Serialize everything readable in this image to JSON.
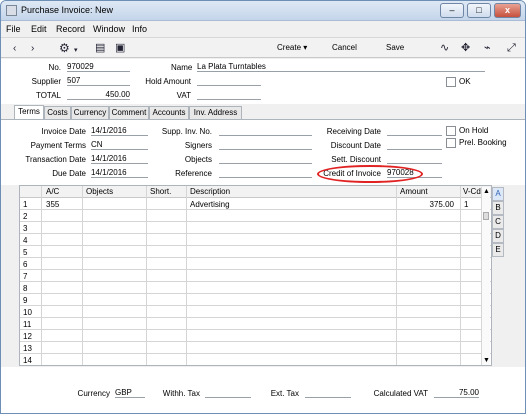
{
  "window": {
    "title": "Purchase Invoice: New",
    "controls": [
      "–",
      "□",
      "x"
    ]
  },
  "menu": [
    "File",
    "Edit",
    "Record",
    "Window",
    "Info"
  ],
  "toolbar": {
    "icons": [
      "back-icon",
      "forward-icon",
      "gear-icon",
      "print-icon",
      "preview-icon",
      "signal-icon",
      "resize-icon",
      "attachment-icon",
      "expand-icon"
    ],
    "create": "Create",
    "cancel": "Cancel",
    "save": "Save",
    "create_arrow": "▾"
  },
  "header": {
    "no_label": "No.",
    "no_value": "970029",
    "name_label": "Name",
    "name_value": "La Plata Turntables",
    "supplier_label": "Supplier",
    "supplier_value": "507",
    "hold_amount_label": "Hold Amount",
    "hold_amount_value": "",
    "ok_label": "OK",
    "total_label": "TOTAL",
    "total_value": "450.00",
    "vat_label": "VAT",
    "vat_value": ""
  },
  "tabs": [
    "Terms",
    "Costs",
    "Currency",
    "Comment",
    "Accounts",
    "Inv. Address"
  ],
  "terms": {
    "invoice_date_label": "Invoice Date",
    "invoice_date_value": "14/1/2016",
    "payment_terms_label": "Payment Terms",
    "payment_terms_value": "CN",
    "transaction_date_label": "Transaction Date",
    "transaction_date_value": "14/1/2016",
    "due_date_label": "Due Date",
    "due_date_value": "14/1/2016",
    "supp_inv_no_label": "Supp. Inv. No.",
    "supp_inv_no_value": "",
    "signers_label": "Signers",
    "signers_value": "",
    "objects_label": "Objects",
    "objects_value": "",
    "reference_label": "Reference",
    "reference_value": "",
    "receiving_date_label": "Receiving Date",
    "receiving_date_value": "",
    "discount_date_label": "Discount Date",
    "discount_date_value": "",
    "sett_discount_label": "Sett. Discount",
    "sett_discount_value": "",
    "credit_of_invoice_label": "Credit of Invoice",
    "credit_of_invoice_value": "970028",
    "on_hold_label": "On Hold",
    "prel_booking_label": "Prel. Booking"
  },
  "grid": {
    "columns": [
      "A/C",
      "Objects",
      "Short.",
      "Description",
      "Amount",
      "V-Cd"
    ],
    "rows": [
      {
        "n": "1",
        "ac": "355",
        "objects": "",
        "short": "",
        "description": "Advertising",
        "amount": "375.00",
        "vcd": "1"
      },
      {
        "n": "2",
        "ac": "",
        "objects": "",
        "short": "",
        "description": "",
        "amount": "",
        "vcd": ""
      },
      {
        "n": "3",
        "ac": "",
        "objects": "",
        "short": "",
        "description": "",
        "amount": "",
        "vcd": ""
      },
      {
        "n": "4",
        "ac": "",
        "objects": "",
        "short": "",
        "description": "",
        "amount": "",
        "vcd": ""
      },
      {
        "n": "5",
        "ac": "",
        "objects": "",
        "short": "",
        "description": "",
        "amount": "",
        "vcd": ""
      },
      {
        "n": "6",
        "ac": "",
        "objects": "",
        "short": "",
        "description": "",
        "amount": "",
        "vcd": ""
      },
      {
        "n": "7",
        "ac": "",
        "objects": "",
        "short": "",
        "description": "",
        "amount": "",
        "vcd": ""
      },
      {
        "n": "8",
        "ac": "",
        "objects": "",
        "short": "",
        "description": "",
        "amount": "",
        "vcd": ""
      },
      {
        "n": "9",
        "ac": "",
        "objects": "",
        "short": "",
        "description": "",
        "amount": "",
        "vcd": ""
      },
      {
        "n": "10",
        "ac": "",
        "objects": "",
        "short": "",
        "description": "",
        "amount": "",
        "vcd": ""
      },
      {
        "n": "11",
        "ac": "",
        "objects": "",
        "short": "",
        "description": "",
        "amount": "",
        "vcd": ""
      },
      {
        "n": "12",
        "ac": "",
        "objects": "",
        "short": "",
        "description": "",
        "amount": "",
        "vcd": ""
      },
      {
        "n": "13",
        "ac": "",
        "objects": "",
        "short": "",
        "description": "",
        "amount": "",
        "vcd": ""
      },
      {
        "n": "14",
        "ac": "",
        "objects": "",
        "short": "",
        "description": "",
        "amount": "",
        "vcd": ""
      }
    ],
    "side_tabs": [
      "A",
      "B",
      "C",
      "D",
      "E"
    ]
  },
  "footer": {
    "currency_label": "Currency",
    "currency_value": "GBP",
    "withh_tax_label": "Withh. Tax",
    "withh_tax_value": "",
    "ext_tax_label": "Ext. Tax",
    "ext_tax_value": "",
    "calculated_vat_label": "Calculated VAT",
    "calculated_vat_value": "75.00"
  }
}
